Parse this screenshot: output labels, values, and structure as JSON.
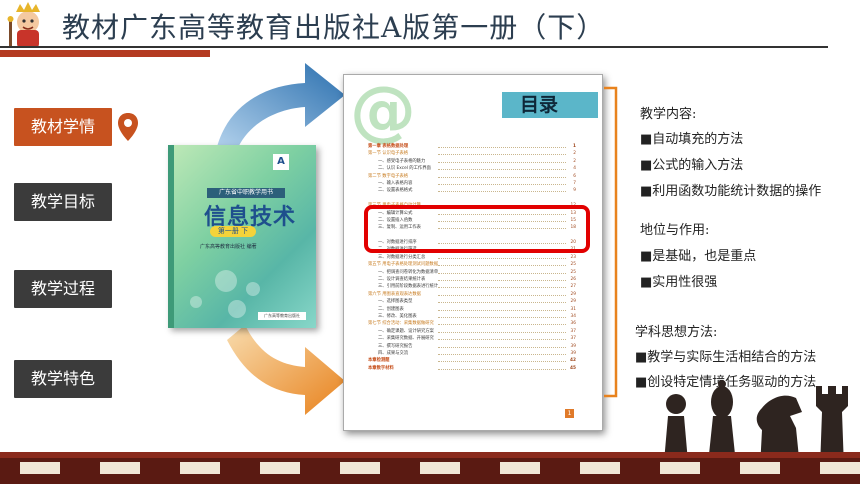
{
  "header": {
    "title": "教材广东高等教育出版社A版第一册（下）"
  },
  "nav": {
    "items": [
      {
        "label": "教材学情",
        "active": true
      },
      {
        "label": "教学目标",
        "active": false
      },
      {
        "label": "教学过程",
        "active": false
      },
      {
        "label": "教学特色",
        "active": false
      }
    ]
  },
  "book": {
    "series": "广东省中职教学用书",
    "title": "信息技术",
    "volume": "第一册  下",
    "badge": "A",
    "publisher": "广东高等教育出版社 编著",
    "label": "广东高等教育出版社"
  },
  "toc": {
    "heading": "目录",
    "lines": [
      {
        "text": "第一章   表格数据处理",
        "page": "1",
        "kind": "ch"
      },
      {
        "text": "第一节   认识电子表格",
        "page": "2",
        "kind": "sec"
      },
      {
        "text": "一、感受电子表格的魅力",
        "page": "2",
        "kind": "sub"
      },
      {
        "text": "二、认识 Excel 的工作界面",
        "page": "4",
        "kind": "sub"
      },
      {
        "text": "第二节   数字电子表格",
        "page": "6",
        "kind": "sec"
      },
      {
        "text": "一、输入表格内容",
        "page": "7",
        "kind": "sub"
      },
      {
        "text": "二、设置表格格式",
        "page": "9",
        "kind": "sub"
      },
      {
        "text": "",
        "page": "",
        "kind": "gap"
      },
      {
        "text": "第三节   用电子表格自动计算",
        "page": "12",
        "kind": "sec"
      },
      {
        "text": "一、编辑计算公式",
        "page": "13",
        "kind": "sub"
      },
      {
        "text": "二、设置插入函数",
        "page": "15",
        "kind": "sub"
      },
      {
        "text": "三、复制、运用工作表",
        "page": "18",
        "kind": "sub"
      },
      {
        "text": "",
        "page": "",
        "kind": "gap"
      },
      {
        "text": "一、对数据进行排序",
        "page": "20",
        "kind": "sub"
      },
      {
        "text": "二、对数据进行筛选",
        "page": "21",
        "kind": "sub"
      },
      {
        "text": "三、对数据进行分类汇总",
        "page": "23",
        "kind": "sub"
      },
      {
        "text": "第五节   用电子表格处理测试问题数据",
        "page": "25",
        "kind": "sec"
      },
      {
        "text": "一、把调查问卷转化为数据清单",
        "page": "25",
        "kind": "sub"
      },
      {
        "text": "二、设计调查结果统计表",
        "page": "26",
        "kind": "sub"
      },
      {
        "text": "三、引用前阶段数据表进行统计",
        "page": "27",
        "kind": "sub"
      },
      {
        "text": "第六节   用图表直观表达数据",
        "page": "29",
        "kind": "sec"
      },
      {
        "text": "一、选择图表类型",
        "page": "29",
        "kind": "sub"
      },
      {
        "text": "二、创建图表",
        "page": "31",
        "kind": "sub"
      },
      {
        "text": "三、修改、美化图表",
        "page": "34",
        "kind": "sub"
      },
      {
        "text": "第七节   综合活动：采集数据做研究",
        "page": "36",
        "kind": "sec"
      },
      {
        "text": "一、确定课题、设计研究方案",
        "page": "37",
        "kind": "sub"
      },
      {
        "text": "二、采集研究数据、开展研究",
        "page": "37",
        "kind": "sub"
      },
      {
        "text": "三、撰写研究报告",
        "page": "39",
        "kind": "sub"
      },
      {
        "text": "四、成果与交流",
        "page": "39",
        "kind": "sub"
      },
      {
        "text": "本章检测题",
        "page": "42",
        "kind": "ch"
      },
      {
        "text": "本章数字材料",
        "page": "45",
        "kind": "ch"
      }
    ],
    "footer_page": "1"
  },
  "content": {
    "teaching_title": "教学内容:",
    "teaching_items": [
      "■自动填充的方法",
      "■公式的输入方法",
      "■利用函数功能统计数据的操作"
    ],
    "status_title": "地位与作用:",
    "status_items": [
      "■是基础，也是重点",
      "■实用性很强"
    ],
    "method_title": "学科思想方法:",
    "method_items": [
      "■教学与实际生活相结合的方法",
      "■创设特定情境任务驱动的方法"
    ]
  },
  "colors": {
    "accent": "#c7521f",
    "nav_dark": "#3b3b3b",
    "highlight": "#e20000",
    "arrow_blue": "#2a6fae",
    "arrow_orange": "#e8821d"
  }
}
